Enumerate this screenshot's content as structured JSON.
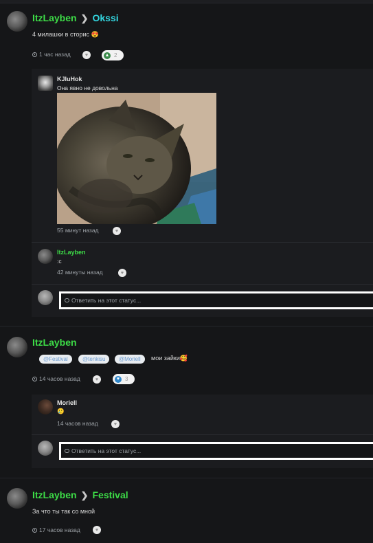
{
  "posts": [
    {
      "author": "ItzLayben",
      "target": "Okssi",
      "text": "4 милашки в сторис",
      "emoji": "😍",
      "time": "1 час назад",
      "reaction_count": "2",
      "comments": [
        {
          "author": "KJluHok",
          "text": "Она явно не довольна",
          "time": "55 минут назад",
          "has_image": true
        },
        {
          "author": "ItzLayben",
          "text": ":c",
          "time": "42 минуты назад"
        }
      ],
      "reply_placeholder": "Ответить на этот статус..."
    },
    {
      "author": "ItzLayben",
      "tags": [
        "@Festival",
        "@tenkisu",
        "@Moriell"
      ],
      "text": "мои зайки",
      "emoji": "🥰",
      "time": "14 часов назад",
      "reaction_count": "3",
      "comments": [
        {
          "author": "Moriell",
          "text": "🥲",
          "time": "14 часов назад"
        }
      ],
      "reply_placeholder": "Ответить на этот статус..."
    },
    {
      "author": "ItzLayben",
      "target": "Festival",
      "text": "За что ты так со мной",
      "time": "17 часов назад"
    }
  ],
  "colors": {
    "username": "#3ddc47",
    "target_okssi": "#33d6e0",
    "background": "#151618",
    "comment_bg": "#1b1c1f"
  },
  "icons": {
    "clock": "clock-icon",
    "like": "heart-icon",
    "upvote": "arrow-up-icon",
    "heart": "heart-icon",
    "comment": "speech-bubble-icon"
  }
}
